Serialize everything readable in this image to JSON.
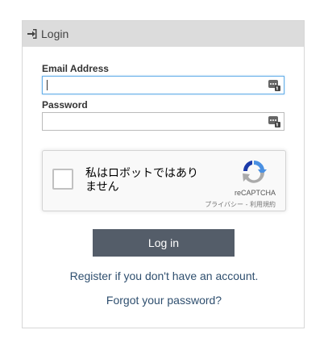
{
  "header": {
    "title": "Login",
    "icon": "sign-in-icon"
  },
  "form": {
    "email_label": "Email Address",
    "email_value": "",
    "password_label": "Password",
    "password_value": ""
  },
  "recaptcha": {
    "checkbox_label": "私はロボットではありません",
    "brand": "reCAPTCHA",
    "links": "プライバシー - 利用規約"
  },
  "actions": {
    "login_label": "Log in",
    "register_link": "Register if you don't have an account.",
    "forgot_link": "Forgot your password?"
  },
  "colors": {
    "header_bg": "#dcdcdc",
    "button_bg": "#545d69",
    "link": "#2f4f6f",
    "focus_border": "#66afe9"
  }
}
